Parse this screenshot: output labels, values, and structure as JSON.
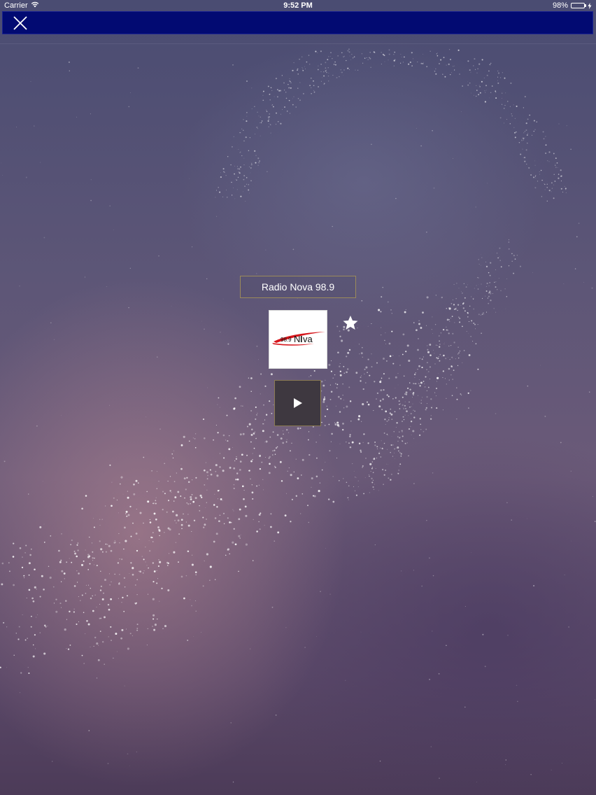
{
  "status_bar": {
    "carrier": "Carrier",
    "wifi_icon": "wifi-icon",
    "time": "9:52 PM",
    "battery_percent": "98%",
    "battery_level": 0.98,
    "battery_color": "#4cd964"
  },
  "nav_bar": {
    "background_color": "#020a72",
    "close_icon": "close-icon"
  },
  "station": {
    "name": "Radio Nova 98.9",
    "logo": {
      "frequency_text": "98.9",
      "brand_text": "N",
      "brand_text_2": "va",
      "accent_color": "#d6161c"
    },
    "favorite_icon": "star-icon",
    "play_icon": "play-icon"
  }
}
